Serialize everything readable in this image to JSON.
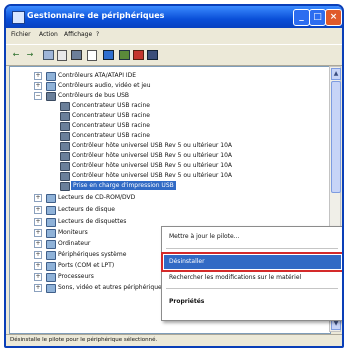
{
  "window": {
    "title": "Gestionnaire de périphériques"
  },
  "menu": [
    "Fichier",
    "Action",
    "Affichage",
    "?"
  ],
  "toolbar": {
    "back_icon": "back-arrow-icon",
    "forward_icon": "forward-arrow-icon"
  },
  "tree": [
    {
      "label": "Contrôleurs ATA/ATAPI IDE",
      "expander": "+",
      "icon": "ide-controller-icon"
    },
    {
      "label": "Contrôleurs audio, vidéo et jeu",
      "expander": "+",
      "icon": "audio-controller-icon"
    },
    {
      "label": "Contrôleurs de bus USB",
      "expander": "−",
      "icon": "usb-controller-icon"
    },
    {
      "label": "Concentrateur USB racine",
      "icon": "usb-device-icon"
    },
    {
      "label": "Concentrateur USB racine",
      "icon": "usb-device-icon"
    },
    {
      "label": "Concentrateur USB racine",
      "icon": "usb-device-icon"
    },
    {
      "label": "Concentrateur USB racine",
      "icon": "usb-device-icon"
    },
    {
      "label": "Contrôleur hôte universel USB Rev 5 ou ultérieur 10A",
      "icon": "usb-device-icon"
    },
    {
      "label": "Contrôleur hôte universel USB Rev 5 ou ultérieur 10A",
      "icon": "usb-device-icon"
    },
    {
      "label": "Contrôleur hôte universel USB Rev 5 ou ultérieur 10A",
      "icon": "usb-device-icon"
    },
    {
      "label": "Contrôleur hôte universel USB Rev 5 ou ultérieur 10A",
      "icon": "usb-device-icon"
    },
    {
      "label": "Prise en charge d'impression USB",
      "icon": "usb-device-icon",
      "selected": true
    },
    {
      "label": "Lecteurs de CD-ROM/DVD",
      "expander": "+",
      "icon": "cdrom-icon"
    },
    {
      "label": "Lecteurs de disque",
      "expander": "+",
      "icon": "disk-icon"
    },
    {
      "label": "Lecteurs de disquettes",
      "expander": "+",
      "icon": "floppy-icon"
    },
    {
      "label": "Moniteurs",
      "expander": "+",
      "icon": "monitor-icon"
    },
    {
      "label": "Ordinateur",
      "expander": "+",
      "icon": "computer-icon"
    },
    {
      "label": "Périphériques système",
      "expander": "+",
      "icon": "system-icon"
    },
    {
      "label": "Ports (COM et LPT)",
      "expander": "+",
      "icon": "port-icon"
    },
    {
      "label": "Processeurs",
      "expander": "+",
      "icon": "cpu-icon"
    },
    {
      "label": "Sons, vidéo et autres périphériques de jeu",
      "expander": "+",
      "icon": "sound-icon"
    }
  ],
  "context_menu": {
    "update_driver": "Mettre à jour le pilote...",
    "uninstall": "Désinstaller",
    "scan": "Rechercher les modifications sur le matériel",
    "properties": "Propriétés"
  },
  "status_bar": "Désinstalle le pilote pour le périphérique sélectionné."
}
